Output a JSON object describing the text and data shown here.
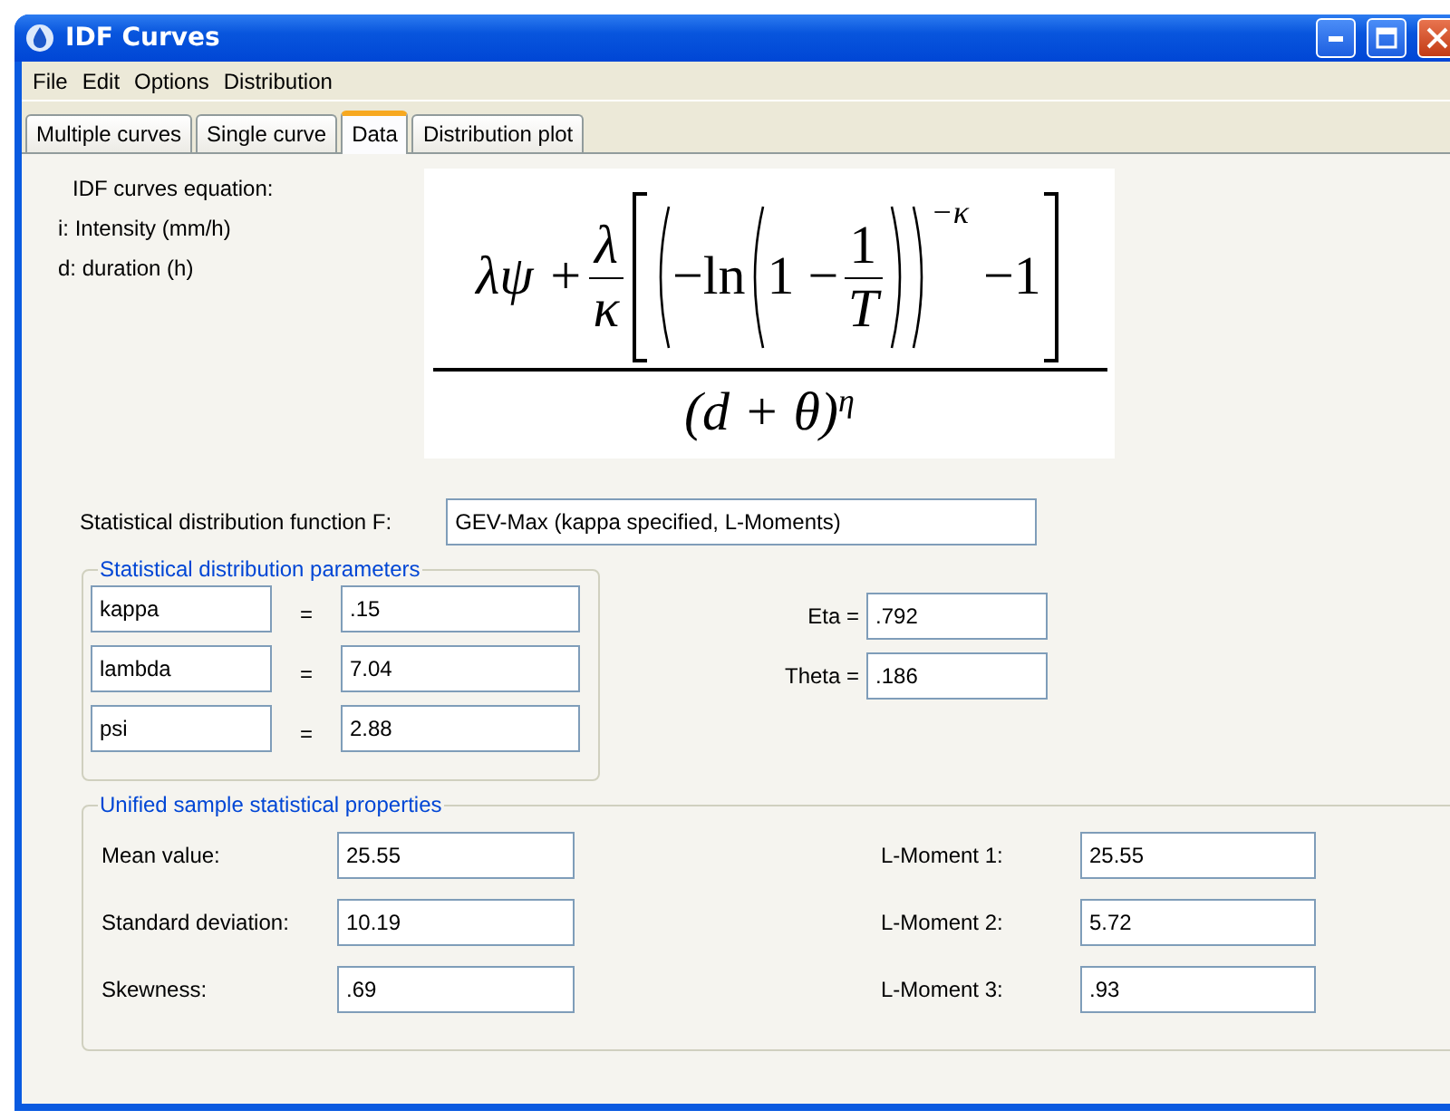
{
  "window": {
    "title": "IDF Curves"
  },
  "menu": [
    "File",
    "Edit",
    "Options",
    "Distribution"
  ],
  "tabs": [
    {
      "label": "Multiple curves",
      "selected": false
    },
    {
      "label": "Single curve",
      "selected": false
    },
    {
      "label": "Data",
      "selected": true
    },
    {
      "label": "Distribution plot",
      "selected": false
    }
  ],
  "equation_legend": [
    "IDF curves equation:",
    "i: Intensity (mm/h)",
    "d: duration (h)"
  ],
  "equation": {
    "lead": "λψ +",
    "coef_num": "λ",
    "coef_den": "κ",
    "ln": "−ln",
    "one_minus": "1 −",
    "inner_num": "1",
    "inner_den": "T",
    "exponent": "−κ",
    "minus_one": "−1",
    "denominator": "(d + θ)",
    "denominator_exponent": "η"
  },
  "distribution_function": {
    "label": "Statistical distribution function F:",
    "value": "GEV-Max (kappa specified, L-Moments)"
  },
  "parameters": {
    "title": "Statistical distribution parameters",
    "rows": [
      {
        "name": "kappa",
        "equals": "=",
        "value": ".15"
      },
      {
        "name": "lambda",
        "equals": "=",
        "value": "7.04"
      },
      {
        "name": "psi",
        "equals": "=",
        "value": "2.88"
      }
    ],
    "extra": [
      {
        "label": "Eta =",
        "value": ".792"
      },
      {
        "label": "Theta =",
        "value": ".186"
      }
    ]
  },
  "properties": {
    "title": "Unified sample statistical properties",
    "left": [
      {
        "label": "Mean value:",
        "value": "25.55"
      },
      {
        "label": "Standard deviation:",
        "value": "10.19"
      },
      {
        "label": "Skewness:",
        "value": ".69"
      }
    ],
    "right": [
      {
        "label": "L-Moment 1:",
        "value": "25.55"
      },
      {
        "label": "L-Moment 2:",
        "value": "5.72"
      },
      {
        "label": "L-Moment 3:",
        "value": ".93"
      }
    ]
  }
}
